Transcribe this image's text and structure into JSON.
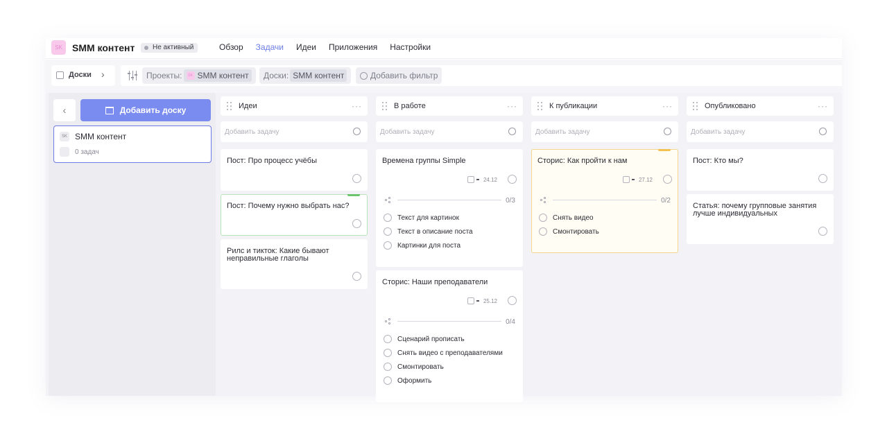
{
  "header": {
    "logo_text": "SK",
    "title": "SMM контент",
    "status": "Не активный",
    "nav": [
      "Обзор",
      "Задачи",
      "Идеи",
      "Приложения",
      "Настройки"
    ],
    "active_nav": "Задачи"
  },
  "filterbar": {
    "boards_label": "Доски",
    "projects_label": "Проекты:",
    "projects_value": "SMM контент",
    "projects_logo": "SK",
    "boards_filter_label": "Доски:",
    "boards_filter_value": "SMM контент",
    "add_filter": "Добавить фильтр"
  },
  "sidebar": {
    "add_board": "Добавить доску",
    "board": {
      "logo": "SK",
      "name": "SMM контент",
      "tasks": "0 задач"
    }
  },
  "add_task_placeholder": "Добавить задачу",
  "columns": [
    {
      "title": "Идеи",
      "cards": [
        {
          "title": "Пост: Про процесс учёбы"
        },
        {
          "title": "Пост: Почему нужно выбрать нас?",
          "tag_color": "#6cc56c"
        },
        {
          "title": "Рилс и тикток: Какие бывают неправильные глаголы"
        }
      ]
    },
    {
      "title": "В работе",
      "cards": [
        {
          "title": "Времена группы Simple",
          "date": "24.12",
          "progress": "0/3",
          "subtasks": [
            "Текст для картинок",
            "Текст в описание поста",
            "Картинки для поста"
          ]
        },
        {
          "title": "Сторис: Наши преподаватели",
          "date": "25.12",
          "progress": "0/4",
          "subtasks": [
            "Сценарий прописать",
            "Снять видео с преподавателями",
            "Смонтировать",
            "Оформить"
          ]
        }
      ]
    },
    {
      "title": "К публикации",
      "cards": [
        {
          "title": "Сторис: Как пройти к нам",
          "date": "27.12",
          "progress": "0/2",
          "tag_color": "#f2c150",
          "subtasks": [
            "Снять видео",
            "Смонтировать"
          ]
        }
      ]
    },
    {
      "title": "Опубликовано",
      "cards": [
        {
          "title": "Пост: Кто мы?"
        },
        {
          "title": "Статья: почему групповые занятия лучше индивидуальных"
        }
      ]
    }
  ],
  "colors": {
    "accent": "#6b7ce6",
    "button": "#7b8cf0"
  }
}
